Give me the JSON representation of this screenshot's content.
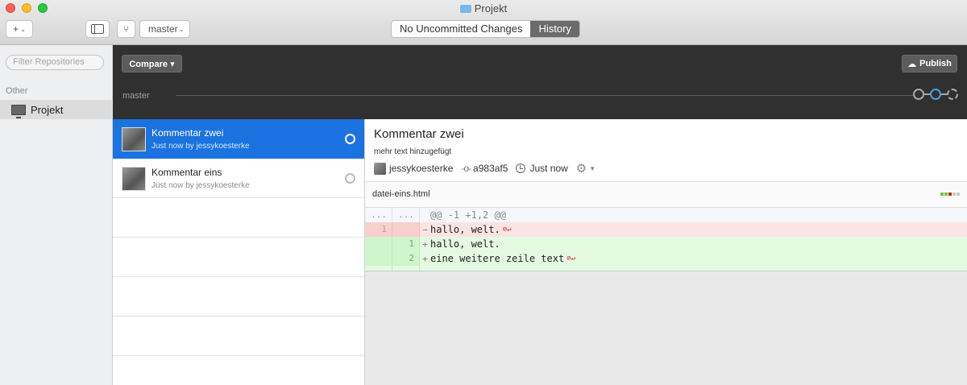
{
  "window": {
    "title": "Projekt",
    "branch_select": "master",
    "add_icon": "plus-icon",
    "tabs": [
      {
        "label": "No Uncommitted Changes"
      },
      {
        "label": "History"
      }
    ]
  },
  "sidebar": {
    "filter_placeholder": "Filter Repositories",
    "section": "Other",
    "items": [
      {
        "label": "Projekt",
        "icon": "monitor-icon"
      }
    ]
  },
  "header": {
    "compare_label": "Compare ▾",
    "publish_label": "Publish",
    "branch_name": "master"
  },
  "commits": [
    {
      "title": "Kommentar zwei",
      "subtitle": "Just now by jessykoesterke",
      "selected": true
    },
    {
      "title": "Kommentar eins",
      "subtitle": "Just now by jessykoesterke",
      "selected": false
    }
  ],
  "detail": {
    "title": "Kommentar zwei",
    "description": "mehr text hinzugefügt",
    "author": "jessykoesterke",
    "sha": "a983af5",
    "time": "Just now",
    "file": "datei-eins.html",
    "diff": {
      "hunk_old": "...",
      "hunk_new": "...",
      "hunk_header": "@@ -1 +1,2 @@",
      "lines": [
        {
          "type": "del",
          "old": "1",
          "new": "",
          "marker": "−",
          "text": "hallo, welt."
        },
        {
          "type": "add",
          "old": "",
          "new": "1",
          "marker": "+",
          "text": "hallo, welt."
        },
        {
          "type": "add",
          "old": "",
          "new": "2",
          "marker": "+",
          "text": "eine weitere zeile text"
        }
      ],
      "eol_glyph": "⊘↵"
    }
  },
  "colors": {
    "selection": "#1a73e0",
    "deletion_bg": "#fde4e4",
    "addition_bg": "#e4fbe2",
    "dark_header": "#303030"
  }
}
